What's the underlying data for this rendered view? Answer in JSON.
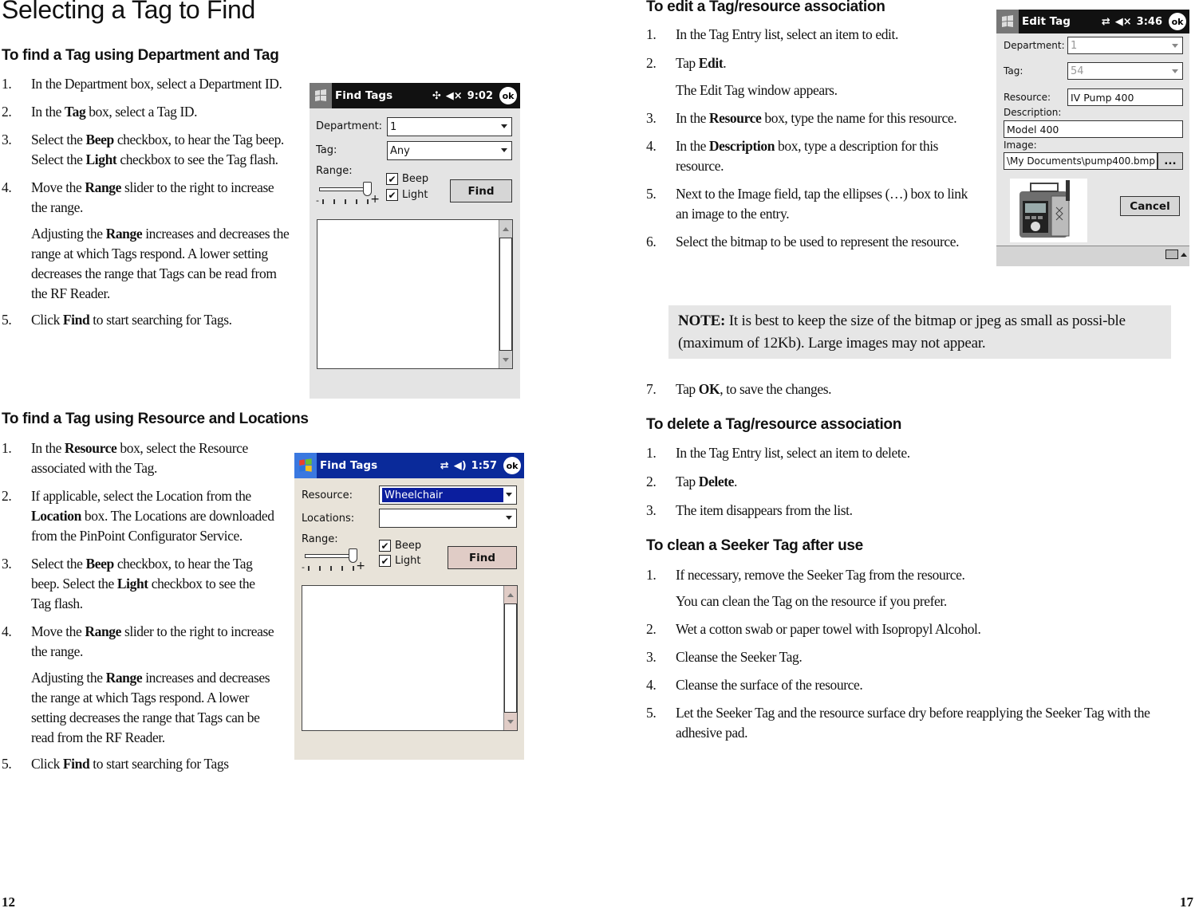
{
  "left_page": {
    "title": "Selecting a Tag to Find",
    "section1": {
      "heading": "To find a Tag using Department and Tag",
      "steps": [
        {
          "num": "1.",
          "parts": [
            {
              "t": "In the Department box, select a Department ID."
            }
          ]
        },
        {
          "num": "2.",
          "parts": [
            {
              "t": "In the "
            },
            {
              "b": "Tag"
            },
            {
              "t": " box, select a Tag ID."
            }
          ]
        },
        {
          "num": "3.",
          "parts": [
            {
              "t": "Select the "
            },
            {
              "b": "Beep"
            },
            {
              "t": " checkbox, to hear the Tag beep. Select the "
            },
            {
              "b": "Light"
            },
            {
              "t": " checkbox to see the Tag flash."
            }
          ]
        },
        {
          "num": "4.",
          "parts": [
            {
              "t": "Move the "
            },
            {
              "b": "Range"
            },
            {
              "t": " slider to the right to increase the range."
            }
          ]
        },
        {
          "num": "",
          "parts": [
            {
              "t": "Adjusting the "
            },
            {
              "b": "Range"
            },
            {
              "t": " increases and decreases the range at which Tags respond. A lower setting decreases the range that Tags can be read from the RF Reader."
            }
          ]
        },
        {
          "num": "5.",
          "parts": [
            {
              "t": "Click "
            },
            {
              "b": "Find"
            },
            {
              "t": " to start searching for Tags."
            }
          ]
        }
      ],
      "screen": {
        "title": "Find Tags",
        "time": "9:02",
        "ok_label": "ok",
        "department_label": "Department:",
        "department_value": "1",
        "tag_label": "Tag:",
        "tag_value": "Any",
        "range_label": "Range:",
        "range_level": 4,
        "range_max": 4,
        "beep_label": "Beep",
        "beep_checked": true,
        "light_label": "Light",
        "light_checked": true,
        "find_label": "Find"
      }
    },
    "section2": {
      "heading": "To find a Tag using Resource and Locations",
      "steps": [
        {
          "num": "1.",
          "parts": [
            {
              "t": "In the "
            },
            {
              "b": "Resource"
            },
            {
              "t": " box, select the Resource associated with the Tag."
            }
          ]
        },
        {
          "num": "2.",
          "parts": [
            {
              "t": "If applicable, select the Location from the "
            },
            {
              "b": "Location"
            },
            {
              "t": " box. The Locations are downloaded from the PinPoint Configurator Service."
            }
          ]
        },
        {
          "num": "3.",
          "parts": [
            {
              "t": "Select the "
            },
            {
              "b": "Beep"
            },
            {
              "t": " checkbox, to hear the Tag beep. Select the "
            },
            {
              "b": "Light"
            },
            {
              "t": " checkbox to see the Tag flash."
            }
          ]
        },
        {
          "num": "4.",
          "parts": [
            {
              "t": "Move the "
            },
            {
              "b": "Range"
            },
            {
              "t": " slider to the right to increase the range."
            }
          ]
        },
        {
          "num": "",
          "parts": [
            {
              "t": "Adjusting the "
            },
            {
              "b": "Range"
            },
            {
              "t": " increases and decreases the range at which Tags respond. A lower setting decreases the range that Tags can be read from the RF Reader."
            }
          ]
        },
        {
          "num": "5.",
          "parts": [
            {
              "t": "Click "
            },
            {
              "b": "Find"
            },
            {
              "t": " to start searching for Tags"
            }
          ]
        }
      ],
      "screen": {
        "title": "Find Tags",
        "time": "1:57",
        "ok_label": "ok",
        "resource_label": "Resource:",
        "resource_value": "Wheelchair",
        "locations_label": "Locations:",
        "locations_value": "",
        "range_label": "Range:",
        "range_level": 4,
        "range_max": 4,
        "beep_label": "Beep",
        "beep_checked": true,
        "light_label": "Light",
        "light_checked": true,
        "find_label": "Find"
      }
    },
    "page_number": "12"
  },
  "right_page": {
    "edit_section": {
      "heading": "To edit a Tag/resource association",
      "steps": [
        {
          "num": "1.",
          "parts": [
            {
              "t": "In the Tag Entry list, select an item to edit."
            }
          ]
        },
        {
          "num": "2.",
          "parts": [
            {
              "t": "Tap "
            },
            {
              "b": "Edit"
            },
            {
              "t": "."
            }
          ]
        },
        {
          "num": "",
          "parts": [
            {
              "t": "The Edit Tag window appears."
            }
          ]
        },
        {
          "num": "3.",
          "parts": [
            {
              "t": "In the "
            },
            {
              "b": "Resource"
            },
            {
              "t": " box, type the name for this resource."
            }
          ]
        },
        {
          "num": "4.",
          "parts": [
            {
              "t": "In the "
            },
            {
              "b": "Description"
            },
            {
              "t": " box, type a description for this resource."
            }
          ]
        },
        {
          "num": "5.",
          "parts": [
            {
              "t": "Next to the Image field, tap the ellipses (…) box to link an image to the entry."
            }
          ]
        },
        {
          "num": "6.",
          "parts": [
            {
              "t": "Select the bitmap to be used to represent the resource."
            }
          ]
        }
      ],
      "note": {
        "label": "NOTE:",
        "text": " It is best to keep the size of the bitmap or jpeg as small as possi-ble (maximum of 12Kb). Large images may not appear."
      },
      "steps_after": [
        {
          "num": "7.",
          "parts": [
            {
              "t": "Tap "
            },
            {
              "b": "OK"
            },
            {
              "t": ", to save the changes."
            }
          ]
        }
      ],
      "screen": {
        "title": "Edit Tag",
        "time": "3:46",
        "ok_label": "ok",
        "department_label": "Department:",
        "department_value": "1",
        "tag_label": "Tag:",
        "tag_value": "54",
        "resource_label": "Resource:",
        "resource_value": "IV Pump 400",
        "description_label": "Description:",
        "description_value": "Model 400",
        "image_label": "Image:",
        "image_value": "\\My Documents\\pump400.bmp",
        "browse_label": "...",
        "cancel_label": "Cancel"
      }
    },
    "delete_section": {
      "heading": "To delete a Tag/resource association",
      "steps": [
        {
          "num": "1.",
          "parts": [
            {
              "t": "In the Tag Entry list, select an item to delete."
            }
          ]
        },
        {
          "num": "2.",
          "parts": [
            {
              "t": "Tap "
            },
            {
              "b": "Delete"
            },
            {
              "t": "."
            }
          ]
        },
        {
          "num": "3.",
          "parts": [
            {
              "t": "The item disappears from the list."
            }
          ]
        }
      ]
    },
    "clean_section": {
      "heading": "To clean a Seeker Tag after use",
      "steps": [
        {
          "num": "1.",
          "parts": [
            {
              "t": "If necessary, remove the Seeker Tag from the resource."
            }
          ]
        },
        {
          "num": "",
          "parts": [
            {
              "t": "You can clean the Tag on the resource if you prefer."
            }
          ]
        },
        {
          "num": "2.",
          "parts": [
            {
              "t": "Wet a cotton swab or paper towel with Isopropyl Alcohol."
            }
          ]
        },
        {
          "num": "3.",
          "parts": [
            {
              "t": "Cleanse the Seeker Tag."
            }
          ]
        },
        {
          "num": "4.",
          "parts": [
            {
              "t": "Cleanse the surface of the resource."
            }
          ]
        },
        {
          "num": "5.",
          "parts": [
            {
              "t": "Let the Seeker Tag and the resource surface dry before reapplying the Seeker Tag with the adhesive pad."
            }
          ]
        }
      ]
    },
    "page_number": "17"
  }
}
